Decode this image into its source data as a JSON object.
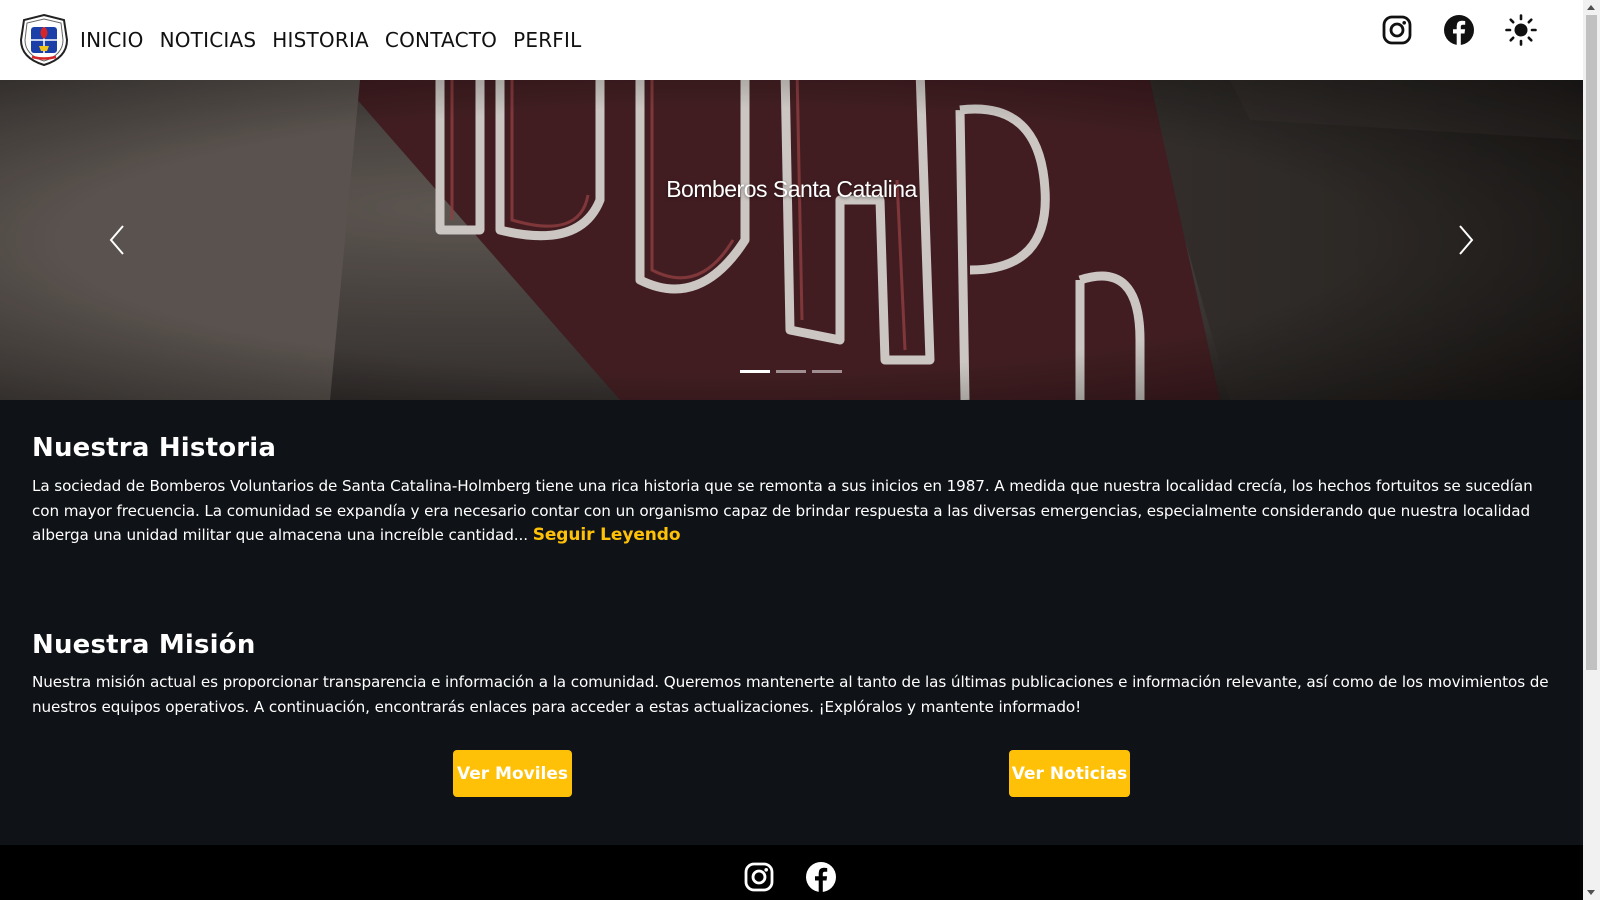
{
  "nav": {
    "links": [
      "INICIO",
      "NOTICIAS",
      "HISTORIA",
      "CONTACTO",
      "PERFIL"
    ],
    "icons": [
      "instagram-icon",
      "facebook-icon",
      "sun-theme-icon"
    ]
  },
  "hero": {
    "caption": "Bomberos Santa Catalina",
    "slides_count": 3,
    "active_slide": 1
  },
  "historia": {
    "title": "Nuestra Historia",
    "text": "La sociedad de Bomberos Voluntarios de Santa Catalina-Holmberg tiene una rica historia que se remonta a sus inicios en 1987. A medida que nuestra localidad crecía, los hechos fortuitos se sucedían con mayor frecuencia. La comunidad se expandía y era necesario contar con un organismo capaz de brindar respuesta a las diversas emergencias, especialmente considerando que nuestra localidad alberga una unidad militar que almacena una increíble cantidad...",
    "read_more": "Seguir Leyendo"
  },
  "mision": {
    "title": "Nuestra Misión",
    "text": "Nuestra misión actual es proporcionar transparencia e información a la comunidad. Queremos mantenerte al tanto de las últimas publicaciones e información relevante, así como de los movimientos de nuestros equipos operativos. A continuación, encontrarás enlaces para acceder a estas actualizaciones. ¡Explóralos y mantente informado!",
    "buttons": [
      "Ver Moviles",
      "Ver Noticias"
    ]
  },
  "footer": {
    "icons": [
      "instagram-icon",
      "facebook-icon"
    ]
  },
  "colors": {
    "accent": "#ffc107",
    "dark_bg": "#0f1216",
    "footer_bg": "#000000"
  }
}
